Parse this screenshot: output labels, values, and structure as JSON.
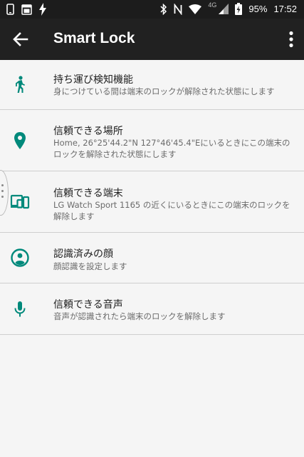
{
  "status_bar": {
    "network": "4G",
    "battery": "95%",
    "time": "17:52",
    "icons": [
      "phone-icon",
      "calendar-icon",
      "flash-icon",
      "bluetooth-icon",
      "nfc-icon",
      "wifi-icon",
      "signal-icon",
      "battery-icon"
    ]
  },
  "app_bar": {
    "title": "Smart Lock",
    "icons": [
      "back-arrow-icon",
      "more-vert-icon"
    ]
  },
  "items": [
    {
      "title": "持ち運び検知機能",
      "subtitle": "身につけている間は端末のロックが解除された状態にします",
      "icon": "walking-person-icon"
    },
    {
      "title": "信頼できる場所",
      "subtitle": "Home, 26°25'44.2\"N 127°46'45.4\"Eにいるときにこの端末のロックを解除された状態にします",
      "icon": "location-pin-icon"
    },
    {
      "title": "信頼できる端末",
      "subtitle": "LG Watch Sport 1165 の近くにいるときにこの端末のロックを解除します",
      "icon": "devices-icon"
    },
    {
      "title": "認識済みの顔",
      "subtitle": "顔認識を設定します",
      "icon": "face-icon"
    },
    {
      "title": "信頼できる音声",
      "subtitle": "音声が認識されたら端末のロックを解除します",
      "icon": "microphone-icon"
    }
  ],
  "colors": {
    "accent": "#00897b",
    "app_bar": "#212121",
    "status_bar": "#1c1c1c",
    "background": "#f5f5f5"
  }
}
